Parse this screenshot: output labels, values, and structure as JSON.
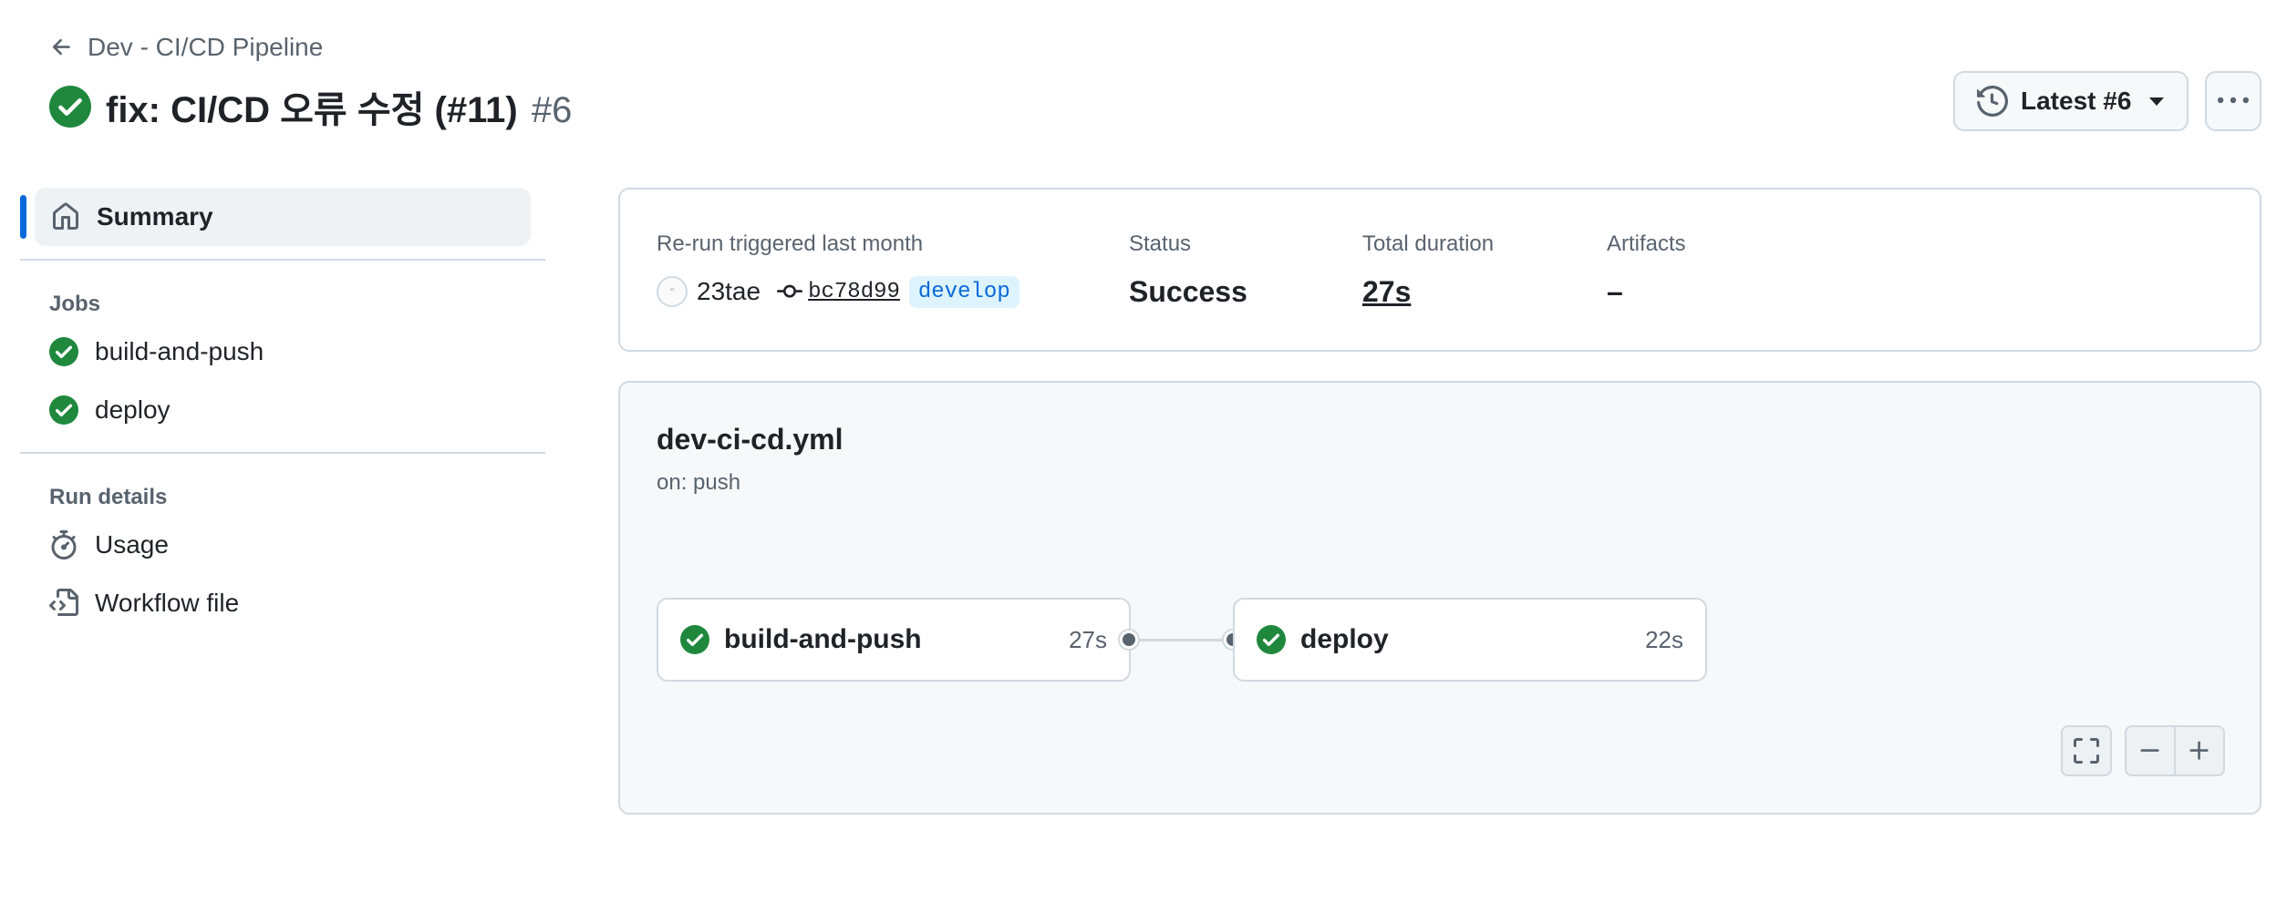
{
  "header": {
    "back_label": "Dev - CI/CD Pipeline",
    "title": "fix: CI/CD 오류 수정 (#11)",
    "run_number": "#6",
    "latest_label": "Latest #6"
  },
  "sidebar": {
    "summary_label": "Summary",
    "jobs_heading": "Jobs",
    "jobs": [
      {
        "label": "build-and-push",
        "status": "success"
      },
      {
        "label": "deploy",
        "status": "success"
      }
    ],
    "run_details_heading": "Run details",
    "run_details": [
      {
        "label": "Usage",
        "icon": "stopwatch-icon"
      },
      {
        "label": "Workflow file",
        "icon": "file-code-icon"
      }
    ]
  },
  "summary": {
    "trigger_label": "Re-run triggered last month",
    "actor": "23tae",
    "commit": "bc78d99",
    "branch": "develop",
    "status_label": "Status",
    "status_value": "Success",
    "duration_label": "Total duration",
    "duration_value": "27s",
    "artifacts_label": "Artifacts",
    "artifacts_value": "–"
  },
  "workflow": {
    "file_name": "dev-ci-cd.yml",
    "trigger": "on: push",
    "jobs": [
      {
        "name": "build-and-push",
        "duration": "27s"
      },
      {
        "name": "deploy",
        "duration": "22s"
      }
    ]
  },
  "colors": {
    "success": "#1f883d",
    "accent": "#0969da",
    "border": "#d1d9e0",
    "muted": "#59636e"
  }
}
